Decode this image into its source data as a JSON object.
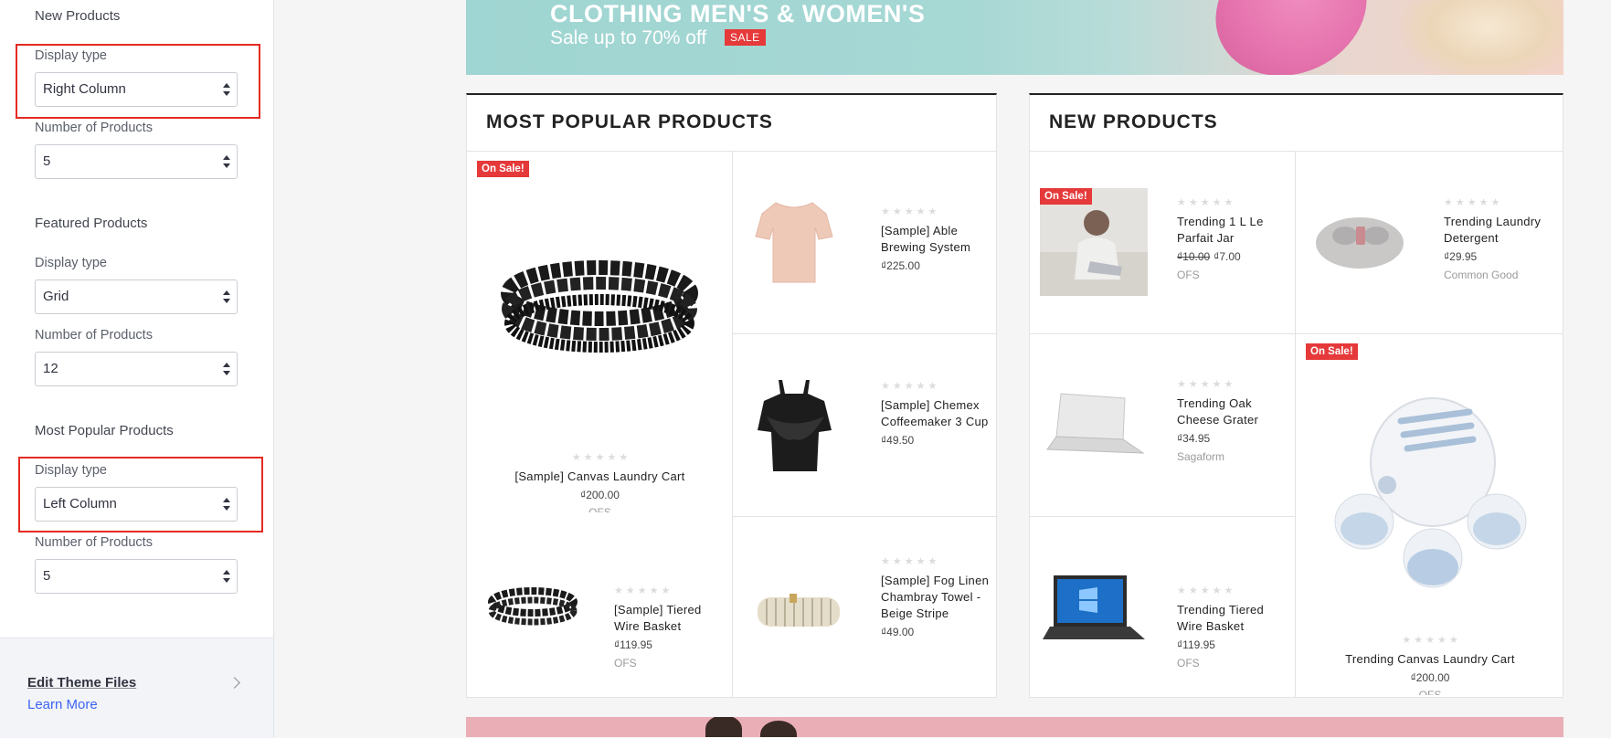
{
  "sidebar": {
    "new_products": {
      "title": "New Products",
      "display_label": "Display type",
      "display_value": "Right Column",
      "number_label": "Number of Products",
      "number_value": "5"
    },
    "featured_products": {
      "title": "Featured Products",
      "display_label": "Display type",
      "display_value": "Grid",
      "number_label": "Number of Products",
      "number_value": "12"
    },
    "most_popular": {
      "title": "Most Popular Products",
      "display_label": "Display type",
      "display_value": "Left Column",
      "number_label": "Number of Products",
      "number_value": "5"
    },
    "footer": {
      "edit_theme": "Edit Theme Files",
      "learn_more": "Learn More"
    }
  },
  "banner_top": {
    "headline": "CLOTHING MEN'S & WOMEN'S",
    "sub": "Sale up to 70% off",
    "badge": "SALE"
  },
  "most_popular_panel": {
    "title": "MOST POPULAR PRODUCTS",
    "featured": {
      "badge": "On Sale!",
      "name": "[Sample] Canvas Laundry Cart",
      "price": "₫200.00",
      "brand": "OFS"
    },
    "items": [
      {
        "name": "[Sample] Tiered Wire Basket",
        "price": "₫119.95",
        "brand": "OFS"
      },
      {
        "name": "[Sample] Able Brewing System",
        "price": "₫225.00"
      },
      {
        "name": "[Sample] Chemex Coffeemaker 3 Cup",
        "price": "₫49.50"
      },
      {
        "name": "[Sample] Fog Linen Chambray Towel - Beige Stripe",
        "price": "₫49.00"
      }
    ]
  },
  "new_products_panel": {
    "title": "NEW PRODUCTS",
    "items": [
      {
        "badge": "On Sale!",
        "name": "Trending 1 L Le Parfait Jar",
        "old_price": "₫10.00",
        "price": "₫7.00",
        "brand": "OFS"
      },
      {
        "name": "Trending Laundry Detergent",
        "price": "₫29.95",
        "brand": "Common Good"
      },
      {
        "name": "Trending Oak Cheese Grater",
        "price": "₫34.95",
        "brand": "Sagaform"
      },
      {
        "name": "Trending Tiered Wire Basket",
        "price": "₫119.95",
        "brand": "OFS"
      }
    ],
    "featured": {
      "badge": "On Sale!",
      "name": "Trending Canvas Laundry Cart",
      "price": "₫200.00",
      "brand": "OFS"
    }
  },
  "colors": {
    "highlight": "#e42b22",
    "sale_badge": "#e5393a",
    "link": "#3c64f4"
  }
}
